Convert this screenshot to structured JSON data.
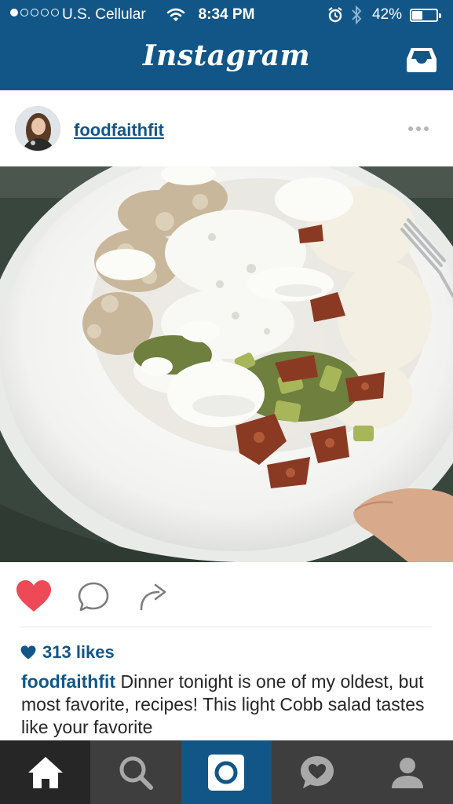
{
  "status_bar": {
    "carrier": "U.S. Cellular",
    "time": "8:34 PM",
    "battery_percent": "42%",
    "battery_level": 0.42,
    "signal_dots_filled": 1,
    "signal_dots_total": 5,
    "icons": [
      "wifi-icon",
      "alarm-icon",
      "bluetooth-icon",
      "battery-icon"
    ]
  },
  "header": {
    "title": "Instagram",
    "inbox_icon": "inbox-tray-icon",
    "color": "#125688"
  },
  "post": {
    "username": "foodfaithfit",
    "more_icon": "more-dots-icon",
    "liked": true,
    "like_color": "#ed4956",
    "likes": "313 likes",
    "caption_user": "foodfaithfit",
    "caption_text": " Dinner tonight is one of my oldest, but most favorite, recipes! This light Cobb salad tastes like your favorite"
  },
  "tabs": [
    {
      "name": "home",
      "icon": "home-icon",
      "active": true
    },
    {
      "name": "explore",
      "icon": "search-icon"
    },
    {
      "name": "camera",
      "icon": "camera-icon"
    },
    {
      "name": "activity",
      "icon": "activity-heart-icon"
    },
    {
      "name": "profile",
      "icon": "profile-icon"
    }
  ]
}
